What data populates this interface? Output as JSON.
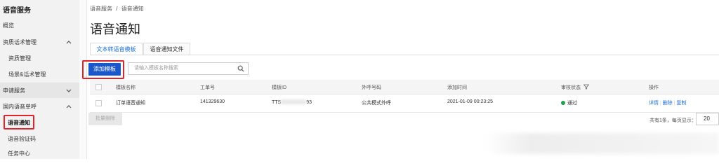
{
  "sidebar": {
    "title": "语音服务",
    "items": [
      {
        "label": "概览"
      },
      {
        "label": "资质话术管理"
      },
      {
        "label": "资质管理"
      },
      {
        "label": "场景&话术管理"
      },
      {
        "label": "申请服务"
      },
      {
        "label": "国内语音单呼"
      },
      {
        "label": "语音通知"
      },
      {
        "label": "语音验证码"
      },
      {
        "label": "任务中心"
      }
    ]
  },
  "breadcrumb": {
    "root": "语音服务",
    "separator": "/",
    "current": "语音通知"
  },
  "page_title": "语音通知",
  "tabs": [
    {
      "label": "文本转语音模板",
      "active": true
    },
    {
      "label": "语音通知文件",
      "active": false
    }
  ],
  "toolbar": {
    "add_label": "添加模板",
    "search_placeholder": "请输入模板名称搜索"
  },
  "table": {
    "headers": [
      "模板名称",
      "工单号",
      "模板ID",
      "外呼号码",
      "添加时间",
      "审核状态",
      "操作"
    ],
    "rows": [
      {
        "name": "订单语音通知",
        "ticket": "141329630",
        "template_id_start": "TTS",
        "template_id_end": "93",
        "caller": "公共模式外呼",
        "added": "2021-01-09 00:23:25",
        "status": "通过",
        "actions": [
          "详情",
          "删除",
          "复制"
        ]
      }
    ]
  },
  "bulk_delete_label": "批量删除",
  "pager": {
    "summary": "共有1条，每页显示：",
    "page_size": "20"
  },
  "colors": {
    "primary": "#1a57c9",
    "link": "#1a6fd6",
    "highlight": "#e0242b",
    "status_ok": "#1aa34a"
  }
}
